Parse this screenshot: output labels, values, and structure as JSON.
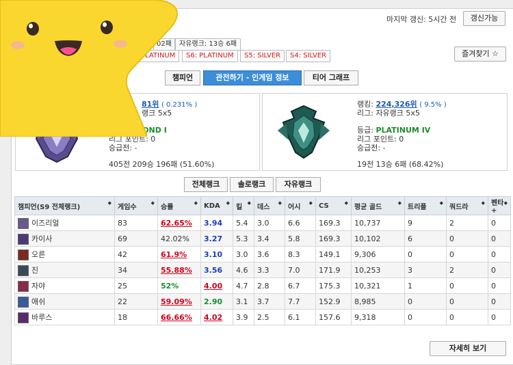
{
  "header": {
    "last_update": "마지막 갱신: 5시간 전",
    "refresh_button": "갱신가능",
    "favorite_button": "즐겨찾기 ☆",
    "solo_record_tail": "02패",
    "flex_record": "자유랭크: 13승 6패"
  },
  "season_tags": [
    "PLATINUM",
    "S6: PLATINUM",
    "S5: SILVER",
    "S4: SILVER"
  ],
  "tabs": [
    "챔피언",
    "관전하기 - 인게임 정보",
    "티어 그래프"
  ],
  "solo_rank": {
    "rank_partial": "81위",
    "pct": "( 0.231% )",
    "queue_partial": "랭크 5x5",
    "tier_label": "등급",
    "tier_partial": "AMOND I",
    "lp": "리그 포인트: 0",
    "promo": "승급전: -",
    "record": "405전 209승 196패 (51.60%)"
  },
  "flex_rank": {
    "rank_label": "랭킹: ",
    "rank": "224,326위",
    "pct": "( 9.5% )",
    "queue": "리그: 자유랭크 5x5",
    "tier_label": "등급: ",
    "tier": "PLATINUM IV",
    "lp": "리그 포인트: 0",
    "promo": "승급전: -",
    "record": "19전 13승 6패 (68.42%)"
  },
  "filters": [
    "전체랭크",
    "솔로랭크",
    "자유랭크"
  ],
  "table": {
    "headers": [
      "챔피언(S9 전체랭크)",
      "게임수",
      "승률",
      "KDA",
      "킬",
      "데스",
      "어시",
      "CS",
      "평균 골드",
      "트리플",
      "쿼드라",
      "펜타+"
    ],
    "rows": [
      {
        "champ": "이즈리얼",
        "color": "#6a5a8a",
        "games": "83",
        "winrate": "62.65%",
        "wr_style": "red",
        "kda": "3.94",
        "kda_style": "blue",
        "k": "5.4",
        "d": "3.0",
        "a": "6.6",
        "cs": "169.3",
        "gold": "10,737",
        "triple": "9",
        "quadra": "2",
        "penta": "0"
      },
      {
        "champ": "카이사",
        "color": "#4b3a78",
        "games": "69",
        "winrate": "42.02%",
        "wr_style": "plain",
        "kda": "3.27",
        "kda_style": "blue",
        "k": "5.3",
        "d": "3.4",
        "a": "5.8",
        "cs": "169.3",
        "gold": "10,102",
        "triple": "6",
        "quadra": "0",
        "penta": "0"
      },
      {
        "champ": "오른",
        "color": "#7a2a1e",
        "games": "42",
        "winrate": "61.9%",
        "wr_style": "red",
        "kda": "3.10",
        "kda_style": "blue",
        "k": "3.0",
        "d": "3.6",
        "a": "8.3",
        "cs": "149.1",
        "gold": "9,306",
        "triple": "0",
        "quadra": "0",
        "penta": "0"
      },
      {
        "champ": "진",
        "color": "#3a4a5a",
        "games": "34",
        "winrate": "55.88%",
        "wr_style": "red",
        "kda": "3.56",
        "kda_style": "blue",
        "k": "4.6",
        "d": "3.3",
        "a": "7.0",
        "cs": "171.9",
        "gold": "10,253",
        "triple": "3",
        "quadra": "2",
        "penta": "0"
      },
      {
        "champ": "자야",
        "color": "#8a2a4a",
        "games": "25",
        "winrate": "52%",
        "wr_style": "green",
        "kda": "4.00",
        "kda_style": "red",
        "k": "4.7",
        "d": "2.8",
        "a": "6.7",
        "cs": "175.3",
        "gold": "10,321",
        "triple": "1",
        "quadra": "0",
        "penta": "0"
      },
      {
        "champ": "애쉬",
        "color": "#3a5a9a",
        "games": "22",
        "winrate": "59.09%",
        "wr_style": "red",
        "kda": "2.90",
        "kda_style": "green",
        "k": "3.1",
        "d": "3.7",
        "a": "7.7",
        "cs": "152.9",
        "gold": "8,985",
        "triple": "0",
        "quadra": "0",
        "penta": "0"
      },
      {
        "champ": "바루스",
        "color": "#5a2a6a",
        "games": "18",
        "winrate": "66.66%",
        "wr_style": "red",
        "kda": "4.02",
        "kda_style": "red",
        "k": "3.9",
        "d": "2.5",
        "a": "6.1",
        "cs": "157.6",
        "gold": "9,318",
        "triple": "0",
        "quadra": "0",
        "penta": "0"
      }
    ]
  },
  "more_button": "자세히 보기"
}
